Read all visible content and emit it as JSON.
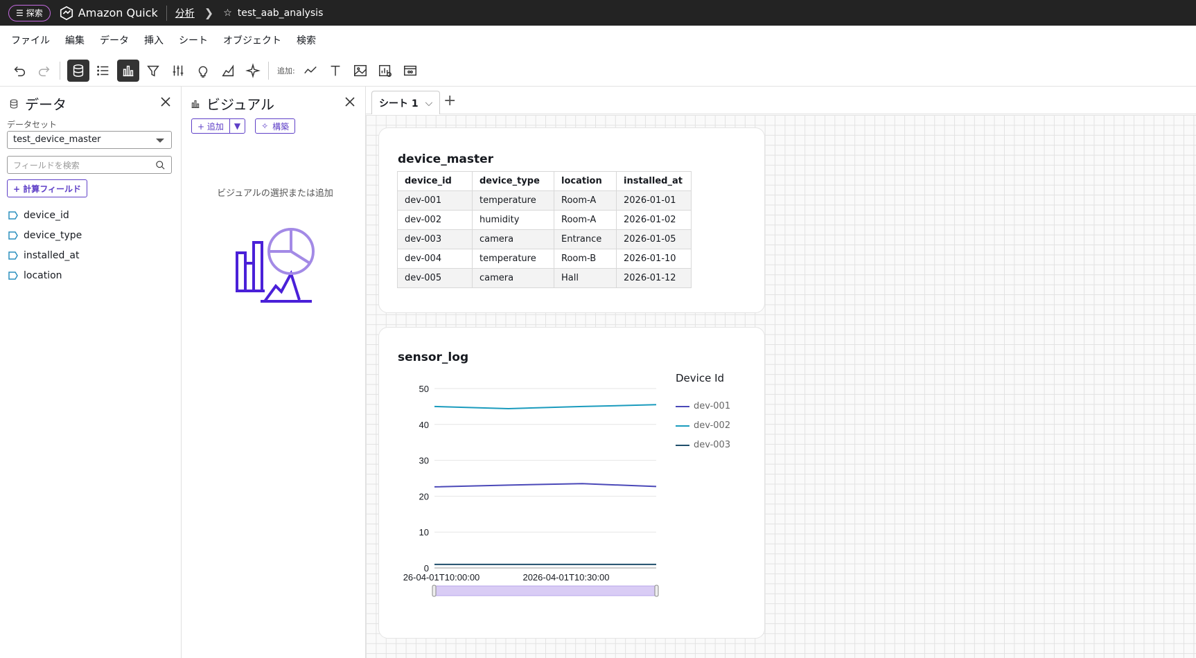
{
  "topbar": {
    "explore_label": "探索",
    "brand": "Amazon Quick",
    "breadcrumb_link": "分析",
    "analysis_title": "test_aab_analysis"
  },
  "menu": [
    "ファイル",
    "編集",
    "データ",
    "挿入",
    "シート",
    "オブジェクト",
    "検索"
  ],
  "toolbar": {
    "add_label": "追加:"
  },
  "data_panel": {
    "title": "データ",
    "dataset_label": "データセット",
    "dataset_value": "test_device_master",
    "search_placeholder": "フィールドを検索",
    "calc_field_label": "+ 計算フィールド",
    "fields": [
      "device_id",
      "device_type",
      "installed_at",
      "location"
    ]
  },
  "visual_panel": {
    "title": "ビジュアル",
    "add_label": "+ 追加",
    "build_label": "構築",
    "empty_text": "ビジュアルの選択または追加"
  },
  "sheet": {
    "tab_label": "シート 1",
    "add_icon": "+"
  },
  "device_master": {
    "title": "device_master",
    "columns": [
      "device_id",
      "device_type",
      "location",
      "installed_at"
    ],
    "rows": [
      [
        "dev-001",
        "temperature",
        "Room-A",
        "2026-01-01"
      ],
      [
        "dev-002",
        "humidity",
        "Room-A",
        "2026-01-02"
      ],
      [
        "dev-003",
        "camera",
        "Entrance",
        "2026-01-05"
      ],
      [
        "dev-004",
        "temperature",
        "Room-B",
        "2026-01-10"
      ],
      [
        "dev-005",
        "camera",
        "Hall",
        "2026-01-12"
      ]
    ]
  },
  "sensor_log": {
    "title": "sensor_log",
    "legend_title": "Device Id",
    "chart_data": {
      "type": "line",
      "title": "sensor_log",
      "xlabel": "",
      "ylabel": "",
      "ylim": [
        0,
        50
      ],
      "yticks": [
        0,
        10,
        20,
        30,
        40,
        50
      ],
      "x_tick_labels": [
        "26-04-01T10:00:00",
        "2026-04-01T10:30:00"
      ],
      "x": [
        0,
        1,
        2,
        3
      ],
      "grid": true,
      "legend": "right",
      "series": [
        {
          "name": "dev-001",
          "color": "#4a48b8",
          "values": [
            22.6,
            23.1,
            23.5,
            22.7
          ]
        },
        {
          "name": "dev-002",
          "color": "#1a9bbd",
          "values": [
            45.0,
            44.4,
            45.0,
            45.5
          ]
        },
        {
          "name": "dev-003",
          "color": "#1f4e6b",
          "values": [
            1.0,
            1.0,
            1.0,
            1.0
          ]
        }
      ]
    }
  }
}
